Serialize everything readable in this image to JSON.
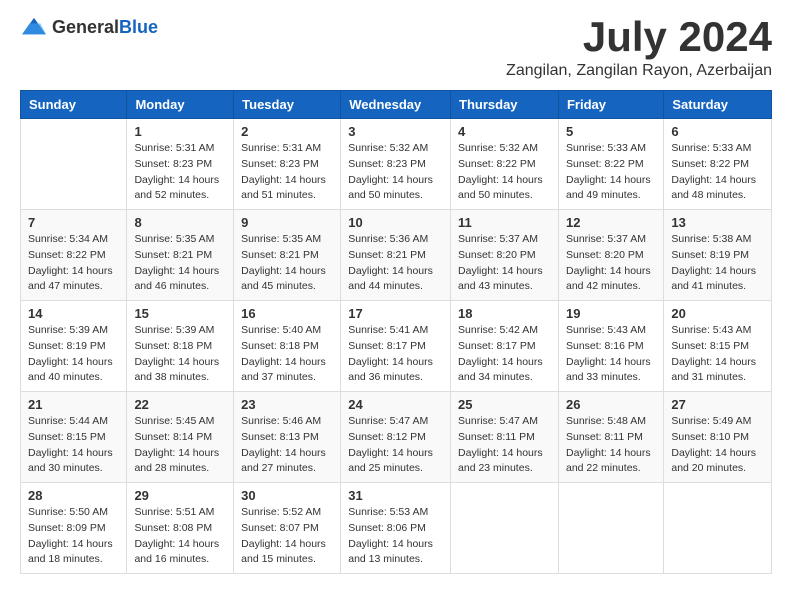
{
  "logo": {
    "general": "General",
    "blue": "Blue"
  },
  "title": {
    "month": "July 2024",
    "location": "Zangilan, Zangilan Rayon, Azerbaijan"
  },
  "weekdays": [
    "Sunday",
    "Monday",
    "Tuesday",
    "Wednesday",
    "Thursday",
    "Friday",
    "Saturday"
  ],
  "weeks": [
    [
      {
        "day": "",
        "sunrise": "",
        "sunset": "",
        "daylight": ""
      },
      {
        "day": "1",
        "sunrise": "Sunrise: 5:31 AM",
        "sunset": "Sunset: 8:23 PM",
        "daylight": "Daylight: 14 hours and 52 minutes."
      },
      {
        "day": "2",
        "sunrise": "Sunrise: 5:31 AM",
        "sunset": "Sunset: 8:23 PM",
        "daylight": "Daylight: 14 hours and 51 minutes."
      },
      {
        "day": "3",
        "sunrise": "Sunrise: 5:32 AM",
        "sunset": "Sunset: 8:23 PM",
        "daylight": "Daylight: 14 hours and 50 minutes."
      },
      {
        "day": "4",
        "sunrise": "Sunrise: 5:32 AM",
        "sunset": "Sunset: 8:22 PM",
        "daylight": "Daylight: 14 hours and 50 minutes."
      },
      {
        "day": "5",
        "sunrise": "Sunrise: 5:33 AM",
        "sunset": "Sunset: 8:22 PM",
        "daylight": "Daylight: 14 hours and 49 minutes."
      },
      {
        "day": "6",
        "sunrise": "Sunrise: 5:33 AM",
        "sunset": "Sunset: 8:22 PM",
        "daylight": "Daylight: 14 hours and 48 minutes."
      }
    ],
    [
      {
        "day": "7",
        "sunrise": "Sunrise: 5:34 AM",
        "sunset": "Sunset: 8:22 PM",
        "daylight": "Daylight: 14 hours and 47 minutes."
      },
      {
        "day": "8",
        "sunrise": "Sunrise: 5:35 AM",
        "sunset": "Sunset: 8:21 PM",
        "daylight": "Daylight: 14 hours and 46 minutes."
      },
      {
        "day": "9",
        "sunrise": "Sunrise: 5:35 AM",
        "sunset": "Sunset: 8:21 PM",
        "daylight": "Daylight: 14 hours and 45 minutes."
      },
      {
        "day": "10",
        "sunrise": "Sunrise: 5:36 AM",
        "sunset": "Sunset: 8:21 PM",
        "daylight": "Daylight: 14 hours and 44 minutes."
      },
      {
        "day": "11",
        "sunrise": "Sunrise: 5:37 AM",
        "sunset": "Sunset: 8:20 PM",
        "daylight": "Daylight: 14 hours and 43 minutes."
      },
      {
        "day": "12",
        "sunrise": "Sunrise: 5:37 AM",
        "sunset": "Sunset: 8:20 PM",
        "daylight": "Daylight: 14 hours and 42 minutes."
      },
      {
        "day": "13",
        "sunrise": "Sunrise: 5:38 AM",
        "sunset": "Sunset: 8:19 PM",
        "daylight": "Daylight: 14 hours and 41 minutes."
      }
    ],
    [
      {
        "day": "14",
        "sunrise": "Sunrise: 5:39 AM",
        "sunset": "Sunset: 8:19 PM",
        "daylight": "Daylight: 14 hours and 40 minutes."
      },
      {
        "day": "15",
        "sunrise": "Sunrise: 5:39 AM",
        "sunset": "Sunset: 8:18 PM",
        "daylight": "Daylight: 14 hours and 38 minutes."
      },
      {
        "day": "16",
        "sunrise": "Sunrise: 5:40 AM",
        "sunset": "Sunset: 8:18 PM",
        "daylight": "Daylight: 14 hours and 37 minutes."
      },
      {
        "day": "17",
        "sunrise": "Sunrise: 5:41 AM",
        "sunset": "Sunset: 8:17 PM",
        "daylight": "Daylight: 14 hours and 36 minutes."
      },
      {
        "day": "18",
        "sunrise": "Sunrise: 5:42 AM",
        "sunset": "Sunset: 8:17 PM",
        "daylight": "Daylight: 14 hours and 34 minutes."
      },
      {
        "day": "19",
        "sunrise": "Sunrise: 5:43 AM",
        "sunset": "Sunset: 8:16 PM",
        "daylight": "Daylight: 14 hours and 33 minutes."
      },
      {
        "day": "20",
        "sunrise": "Sunrise: 5:43 AM",
        "sunset": "Sunset: 8:15 PM",
        "daylight": "Daylight: 14 hours and 31 minutes."
      }
    ],
    [
      {
        "day": "21",
        "sunrise": "Sunrise: 5:44 AM",
        "sunset": "Sunset: 8:15 PM",
        "daylight": "Daylight: 14 hours and 30 minutes."
      },
      {
        "day": "22",
        "sunrise": "Sunrise: 5:45 AM",
        "sunset": "Sunset: 8:14 PM",
        "daylight": "Daylight: 14 hours and 28 minutes."
      },
      {
        "day": "23",
        "sunrise": "Sunrise: 5:46 AM",
        "sunset": "Sunset: 8:13 PM",
        "daylight": "Daylight: 14 hours and 27 minutes."
      },
      {
        "day": "24",
        "sunrise": "Sunrise: 5:47 AM",
        "sunset": "Sunset: 8:12 PM",
        "daylight": "Daylight: 14 hours and 25 minutes."
      },
      {
        "day": "25",
        "sunrise": "Sunrise: 5:47 AM",
        "sunset": "Sunset: 8:11 PM",
        "daylight": "Daylight: 14 hours and 23 minutes."
      },
      {
        "day": "26",
        "sunrise": "Sunrise: 5:48 AM",
        "sunset": "Sunset: 8:11 PM",
        "daylight": "Daylight: 14 hours and 22 minutes."
      },
      {
        "day": "27",
        "sunrise": "Sunrise: 5:49 AM",
        "sunset": "Sunset: 8:10 PM",
        "daylight": "Daylight: 14 hours and 20 minutes."
      }
    ],
    [
      {
        "day": "28",
        "sunrise": "Sunrise: 5:50 AM",
        "sunset": "Sunset: 8:09 PM",
        "daylight": "Daylight: 14 hours and 18 minutes."
      },
      {
        "day": "29",
        "sunrise": "Sunrise: 5:51 AM",
        "sunset": "Sunset: 8:08 PM",
        "daylight": "Daylight: 14 hours and 16 minutes."
      },
      {
        "day": "30",
        "sunrise": "Sunrise: 5:52 AM",
        "sunset": "Sunset: 8:07 PM",
        "daylight": "Daylight: 14 hours and 15 minutes."
      },
      {
        "day": "31",
        "sunrise": "Sunrise: 5:53 AM",
        "sunset": "Sunset: 8:06 PM",
        "daylight": "Daylight: 14 hours and 13 minutes."
      },
      {
        "day": "",
        "sunrise": "",
        "sunset": "",
        "daylight": ""
      },
      {
        "day": "",
        "sunrise": "",
        "sunset": "",
        "daylight": ""
      },
      {
        "day": "",
        "sunrise": "",
        "sunset": "",
        "daylight": ""
      }
    ]
  ]
}
